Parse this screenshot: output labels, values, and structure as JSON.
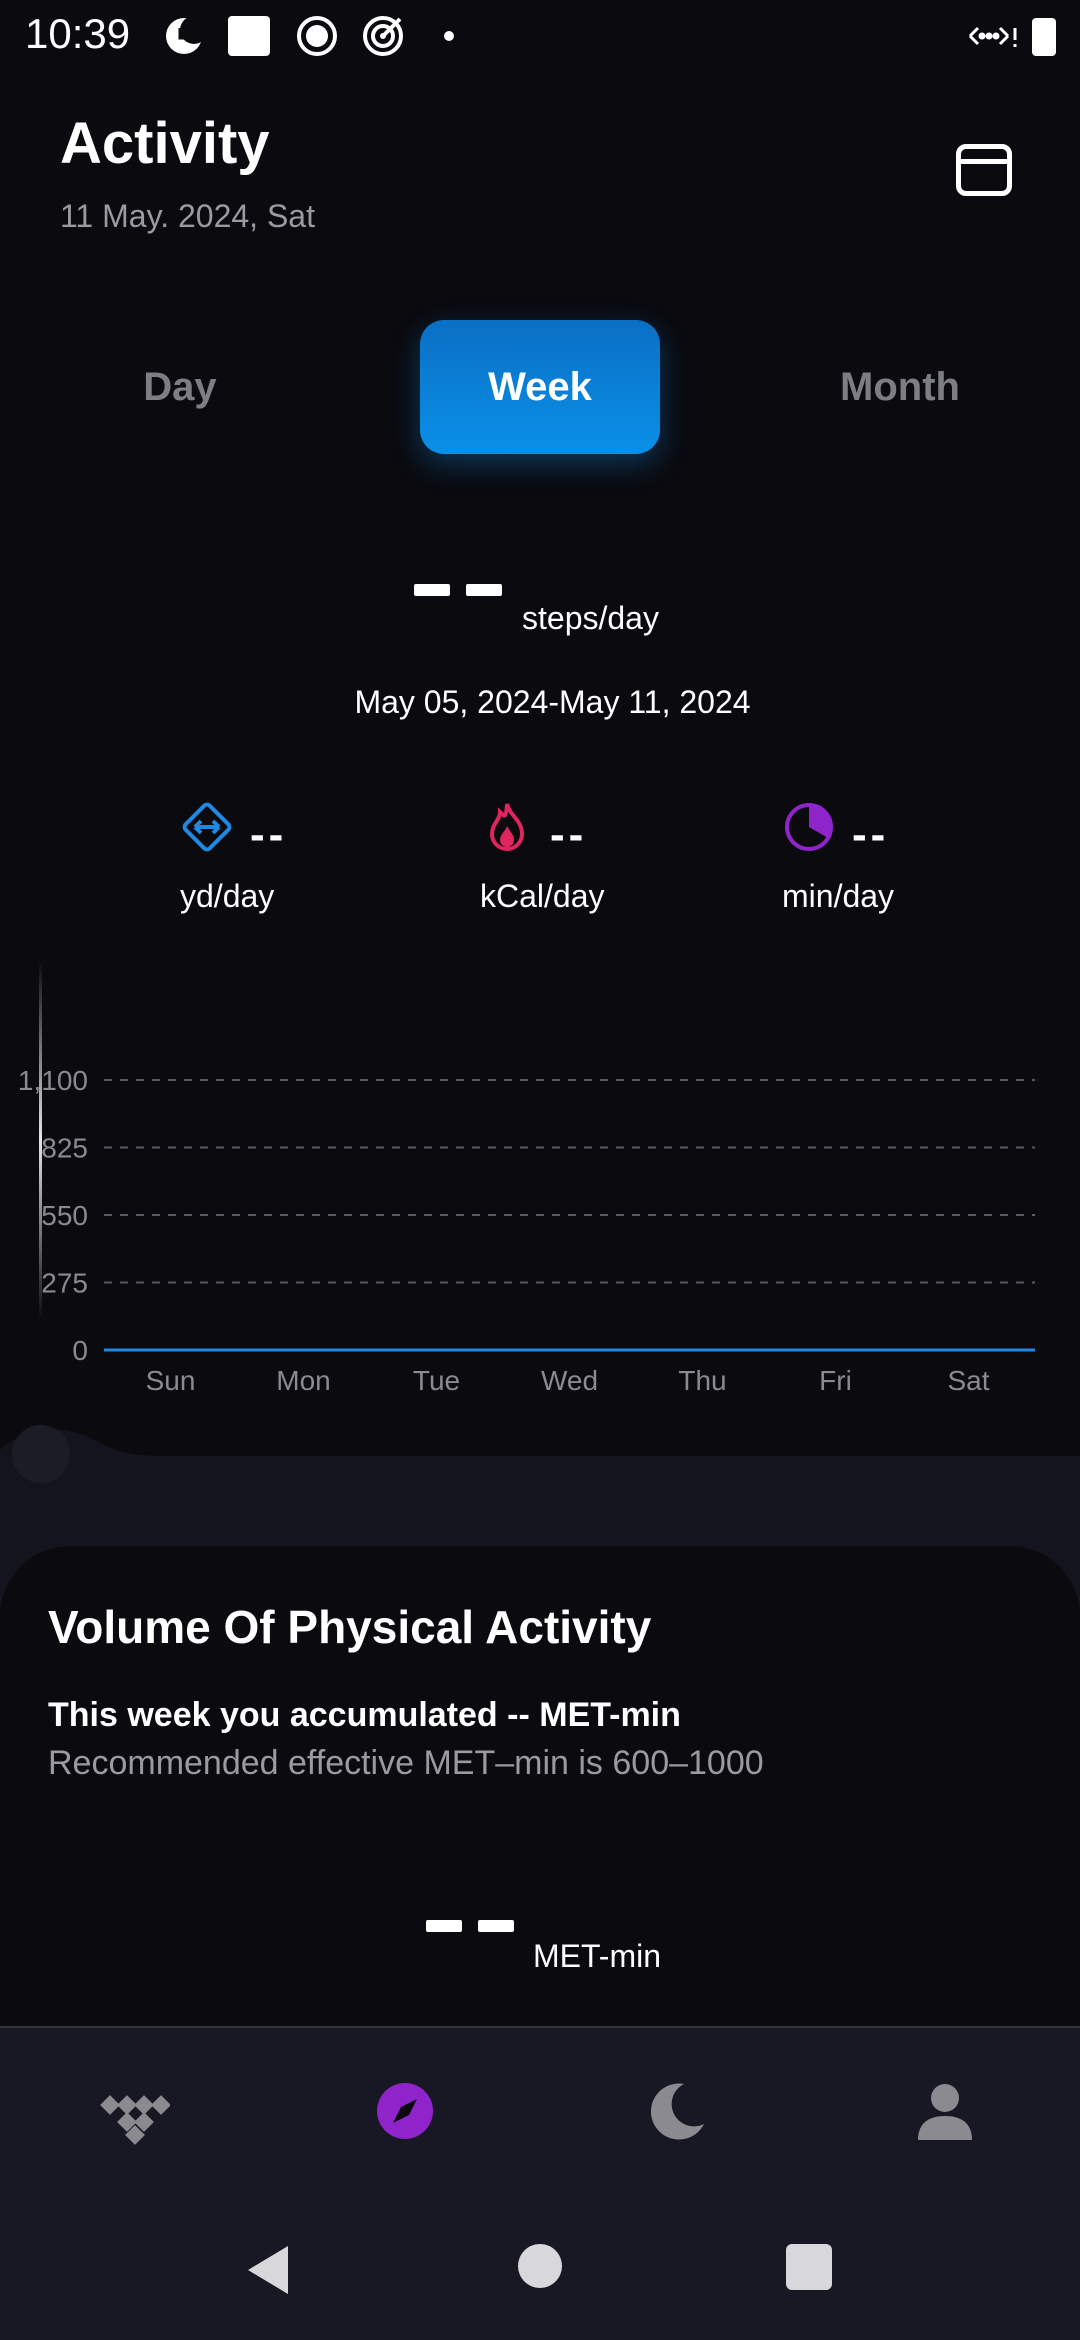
{
  "status_bar": {
    "time": "10:39"
  },
  "header": {
    "title": "Activity",
    "date": "11 May. 2024, Sat"
  },
  "tabs": [
    {
      "label": "Day",
      "selected": false
    },
    {
      "label": "Week",
      "selected": true
    },
    {
      "label": "Month",
      "selected": false
    }
  ],
  "summary": {
    "steps_unit": "steps/day",
    "date_range": "May 05, 2024-May 11, 2024"
  },
  "stats": {
    "distance": {
      "value": "--",
      "unit": "yd/day",
      "icon": "distance-icon",
      "color": "#1e88e5"
    },
    "calories": {
      "value": "--",
      "unit": "kCal/day",
      "icon": "flame-icon",
      "color": "#e0245e"
    },
    "duration": {
      "value": "--",
      "unit": "min/day",
      "icon": "clock-icon",
      "color": "#8e24c9"
    }
  },
  "chart_data": {
    "type": "bar",
    "categories": [
      "Sun",
      "Mon",
      "Tue",
      "Wed",
      "Thu",
      "Fri",
      "Sat"
    ],
    "series": [
      {
        "values": [
          0,
          0,
          0,
          0,
          0,
          0,
          0
        ]
      }
    ],
    "yticks": [
      "0",
      "275",
      "550",
      "825",
      "1,100"
    ],
    "ytick_values": [
      0,
      275,
      550,
      825,
      1100
    ],
    "ylim": [
      0,
      1100
    ],
    "grid": true,
    "baseline_color": "#1e88e5"
  },
  "met": {
    "title": "Volume Of Physical Activity",
    "week_text": "This week you accumulated -- MET-min",
    "recommend_text": "Recommended effective MET–min is 600–1000",
    "unit": "MET-min"
  },
  "bottom_nav": [
    {
      "name": "dashboard",
      "icon": "dashboard-icon"
    },
    {
      "name": "activity",
      "icon": "compass-icon",
      "active_color": "#8e24c9"
    },
    {
      "name": "sleep",
      "icon": "moon-icon"
    },
    {
      "name": "profile",
      "icon": "person-icon"
    }
  ]
}
